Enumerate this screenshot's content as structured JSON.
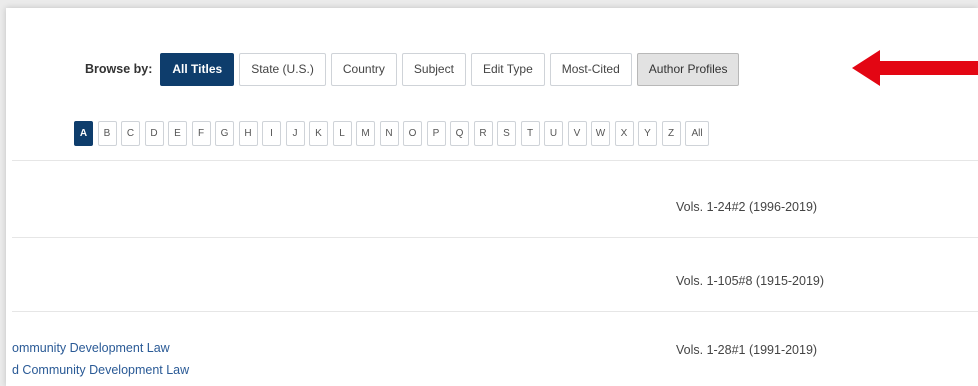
{
  "browse": {
    "label": "Browse by:",
    "buttons": [
      {
        "label": "All Titles",
        "active": true
      },
      {
        "label": "State (U.S.)"
      },
      {
        "label": "Country"
      },
      {
        "label": "Subject"
      },
      {
        "label": "Edit Type"
      },
      {
        "label": "Most-Cited"
      },
      {
        "label": "Author Profiles"
      }
    ]
  },
  "annotation": {
    "arrow_color": "#e30613",
    "icon": "arrow-left-icon"
  },
  "alphabet": [
    "A",
    "B",
    "C",
    "D",
    "E",
    "F",
    "G",
    "H",
    "I",
    "J",
    "K",
    "L",
    "M",
    "N",
    "O",
    "P",
    "Q",
    "R",
    "S",
    "T",
    "U",
    "V",
    "W",
    "X",
    "Y",
    "Z",
    "All"
  ],
  "alphabet_active": "A",
  "rows": [
    {
      "vols": "Vols. 1-24#2 (1996-2019)"
    },
    {
      "vols": "Vols. 1-105#8 (1915-2019)"
    },
    {
      "vols": "Vols. 1-28#1 (1991-2019)",
      "titles": [
        "ommunity Development Law",
        "d Community Development Law"
      ]
    }
  ],
  "colors": {
    "primary": "#0e3d6c",
    "link": "#2a5a96"
  }
}
